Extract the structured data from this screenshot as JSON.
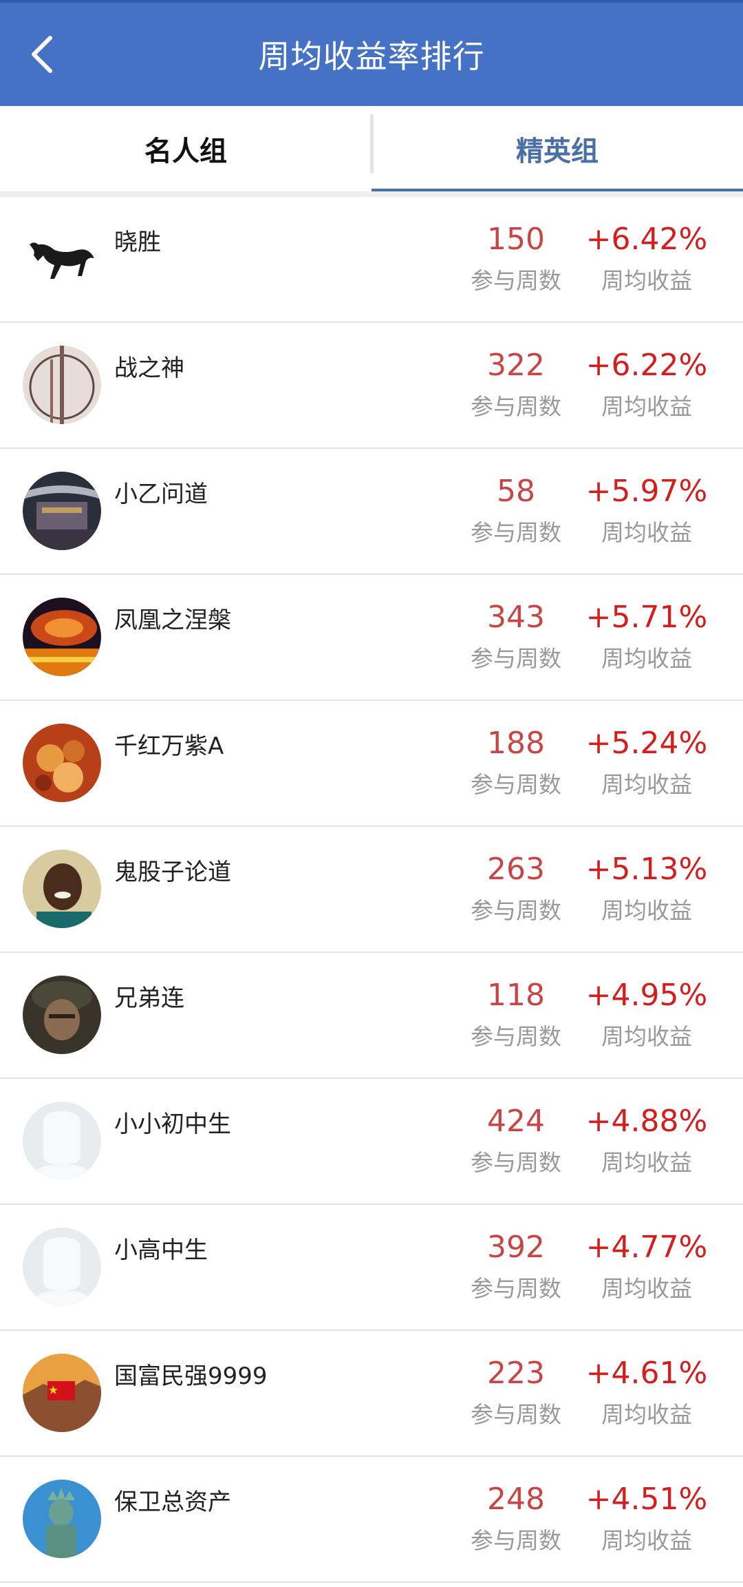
{
  "header": {
    "title": "周均收益率排行",
    "back_icon": "chevron-left-icon"
  },
  "tabs": [
    {
      "label": "名人组",
      "active": false
    },
    {
      "label": "精英组",
      "active": true
    }
  ],
  "columns": {
    "weeks_caption": "参与周数",
    "return_caption": "周均收益"
  },
  "colors": {
    "header": "#4572c4",
    "weeks": "#c94545",
    "return": "#d41e1e",
    "tab_active": "#4a6fa5"
  },
  "rows": [
    {
      "name": "晓胜",
      "weeks": "150",
      "return": "+6.42%",
      "avatar": "horse-avatar"
    },
    {
      "name": "战之神",
      "weeks": "322",
      "return": "+6.22%",
      "avatar": "ferris-wheel-avatar"
    },
    {
      "name": "小乙问道",
      "weeks": "58",
      "return": "+5.97%",
      "avatar": "pagoda-avatar"
    },
    {
      "name": "凤凰之涅槃",
      "weeks": "343",
      "return": "+5.71%",
      "avatar": "fire-sunset-avatar"
    },
    {
      "name": "千红万紫A",
      "weeks": "188",
      "return": "+5.24%",
      "avatar": "flowers-avatar"
    },
    {
      "name": "鬼股子论道",
      "weeks": "263",
      "return": "+5.13%",
      "avatar": "child-portrait-avatar"
    },
    {
      "name": "兄弟连",
      "weeks": "118",
      "return": "+4.95%",
      "avatar": "soldier-avatar"
    },
    {
      "name": "小小初中生",
      "weeks": "424",
      "return": "+4.88%",
      "avatar": "default-user-avatar"
    },
    {
      "name": "小高中生",
      "weeks": "392",
      "return": "+4.77%",
      "avatar": "default-user-avatar"
    },
    {
      "name": "国富民强9999",
      "weeks": "223",
      "return": "+4.61%",
      "avatar": "great-wall-flag-avatar"
    },
    {
      "name": "保卫总资产",
      "weeks": "248",
      "return": "+4.51%",
      "avatar": "statue-of-liberty-avatar"
    }
  ]
}
